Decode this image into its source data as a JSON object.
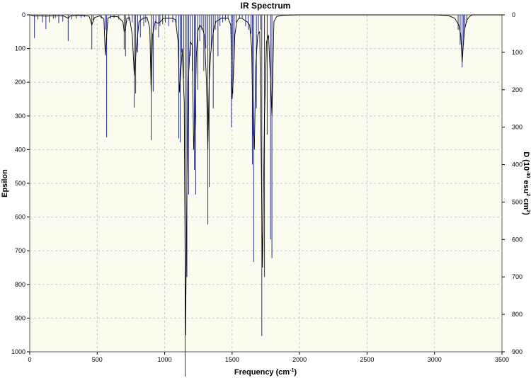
{
  "chart_data": {
    "type": "line",
    "title": "IR Spectrum",
    "xlabel": "Frequency (cm",
    "xlabel_sup": "-1",
    "xlabel_tail": ")",
    "ylabel_left": "Epsilon",
    "ylabel_right_parts": [
      "D (10",
      "-40",
      " esu",
      "2",
      " cm",
      "2",
      ")"
    ],
    "xlim": [
      0,
      3500
    ],
    "ylim_left": [
      0,
      1000
    ],
    "ylim_right": [
      0,
      900
    ],
    "y_inverted": true,
    "grid": true,
    "x_ticks": [
      0,
      500,
      1000,
      1500,
      2000,
      2500,
      3000,
      3500
    ],
    "y_left_ticks": [
      0,
      100,
      200,
      300,
      400,
      500,
      600,
      700,
      800,
      900,
      1000
    ],
    "y_right_ticks": [
      0,
      100,
      200,
      300,
      400,
      500,
      600,
      700,
      800,
      900
    ],
    "colors": {
      "plot_background": "#fbfbf0",
      "spectrum_line": "#000000",
      "stick_line": "#2a2f8f"
    },
    "series": [
      {
        "kind": "sticks",
        "x": [
          35,
          60,
          95,
          120,
          145,
          175,
          190,
          215,
          245,
          285,
          310,
          345,
          380,
          405,
          460,
          470,
          530,
          560,
          570,
          600,
          625,
          660,
          700,
          710,
          735,
          760,
          775,
          785,
          800,
          820,
          845,
          860,
          900,
          915,
          935,
          955,
          965,
          985,
          1005,
          1030,
          1060,
          1085,
          1105,
          1115,
          1125,
          1140,
          1152,
          1165,
          1178,
          1190,
          1205,
          1220,
          1230,
          1245,
          1260,
          1275,
          1290,
          1305,
          1320,
          1330,
          1345,
          1360,
          1375,
          1395,
          1410,
          1430,
          1450,
          1470,
          1495,
          1505,
          1515,
          1530,
          1555,
          1575,
          1600,
          1620,
          1640,
          1650,
          1660,
          1680,
          1695,
          1710,
          1720,
          1740,
          1760,
          1785,
          1795,
          3175,
          3190,
          3205,
          3215,
          3225,
          3240
        ],
        "values": [
          62,
          12,
          20,
          38,
          20,
          10,
          8,
          22,
          18,
          70,
          12,
          10,
          8,
          6,
          92,
          15,
          10,
          40,
          327,
          10,
          8,
          12,
          92,
          110,
          15,
          20,
          248,
          210,
          100,
          60,
          30,
          20,
          335,
          205,
          40,
          60,
          30,
          25,
          20,
          30,
          20,
          30,
          330,
          340,
          100,
          170,
          966,
          700,
          480,
          110,
          150,
          414,
          480,
          200,
          70,
          40,
          150,
          90,
          560,
          460,
          90,
          250,
          40,
          110,
          30,
          20,
          15,
          10,
          300,
          210,
          120,
          20,
          10,
          8,
          30,
          40,
          50,
          400,
          660,
          250,
          50,
          40,
          858,
          700,
          320,
          600,
          650,
          40,
          80,
          140,
          80,
          40,
          20
        ]
      },
      {
        "kind": "envelope",
        "x": [
          0,
          20,
          35,
          50,
          80,
          120,
          160,
          200,
          250,
          285,
          300,
          350,
          400,
          440,
          460,
          480,
          520,
          550,
          560,
          570,
          580,
          600,
          650,
          690,
          700,
          710,
          720,
          740,
          760,
          775,
          790,
          810,
          840,
          870,
          890,
          900,
          910,
          930,
          950,
          970,
          990,
          1010,
          1030,
          1060,
          1080,
          1100,
          1110,
          1120,
          1130,
          1145,
          1155,
          1165,
          1175,
          1190,
          1205,
          1215,
          1225,
          1235,
          1245,
          1260,
          1280,
          1295,
          1310,
          1320,
          1330,
          1340,
          1350,
          1365,
          1380,
          1400,
          1420,
          1445,
          1470,
          1490,
          1500,
          1510,
          1520,
          1535,
          1550,
          1570,
          1590,
          1610,
          1630,
          1645,
          1655,
          1665,
          1675,
          1690,
          1705,
          1715,
          1725,
          1740,
          1755,
          1770,
          1785,
          1795,
          1810,
          1830,
          1860,
          1900,
          2000,
          2500,
          3000,
          3100,
          3150,
          3180,
          3195,
          3205,
          3215,
          3225,
          3240,
          3260,
          3280,
          3500
        ],
        "values": [
          0,
          2,
          4,
          3,
          3,
          4,
          3,
          3,
          3,
          10,
          3,
          2,
          2,
          4,
          30,
          8,
          3,
          12,
          120,
          60,
          10,
          5,
          5,
          20,
          50,
          40,
          10,
          8,
          60,
          180,
          100,
          20,
          10,
          8,
          40,
          230,
          60,
          20,
          25,
          20,
          10,
          10,
          10,
          10,
          15,
          80,
          230,
          170,
          100,
          260,
          950,
          500,
          200,
          80,
          90,
          400,
          300,
          120,
          50,
          30,
          40,
          60,
          200,
          400,
          200,
          120,
          80,
          40,
          20,
          15,
          10,
          10,
          10,
          30,
          250,
          180,
          60,
          20,
          10,
          10,
          15,
          20,
          30,
          100,
          350,
          400,
          150,
          60,
          50,
          400,
          750,
          300,
          80,
          60,
          200,
          300,
          20,
          5,
          2,
          1,
          0,
          0,
          0,
          2,
          10,
          30,
          60,
          140,
          80,
          40,
          15,
          5,
          0,
          0
        ]
      }
    ]
  }
}
